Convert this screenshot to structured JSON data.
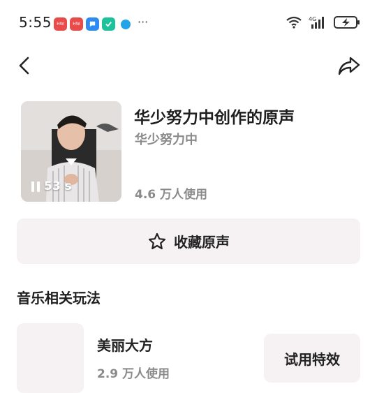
{
  "status_bar": {
    "time": "5:55",
    "notification_icons": [
      "huawei-app-icon",
      "huawei-app-icon",
      "message-icon",
      "security-icon",
      "browser-icon"
    ],
    "more": "···",
    "network": "4G",
    "battery_state": "charging"
  },
  "nav": {
    "back_icon": "chevron-left-icon",
    "share_icon": "share-arrow-icon"
  },
  "sound": {
    "title": "华少努力中创作的原声",
    "author": "华少努力中",
    "usage": "4.6 万人使用",
    "duration": "53 s"
  },
  "favorite_button": {
    "label": "收藏原声",
    "icon": "star-outline-icon"
  },
  "section": {
    "title": "音乐相关玩法"
  },
  "effects": [
    {
      "name": "美丽大方",
      "usage": "2.9 万人使用",
      "button_label": "试用特效"
    }
  ],
  "colors": {
    "card_bg": "#f6f2f4",
    "secondary_text": "#8a8a8a",
    "primary_text": "#1f1f1f"
  }
}
